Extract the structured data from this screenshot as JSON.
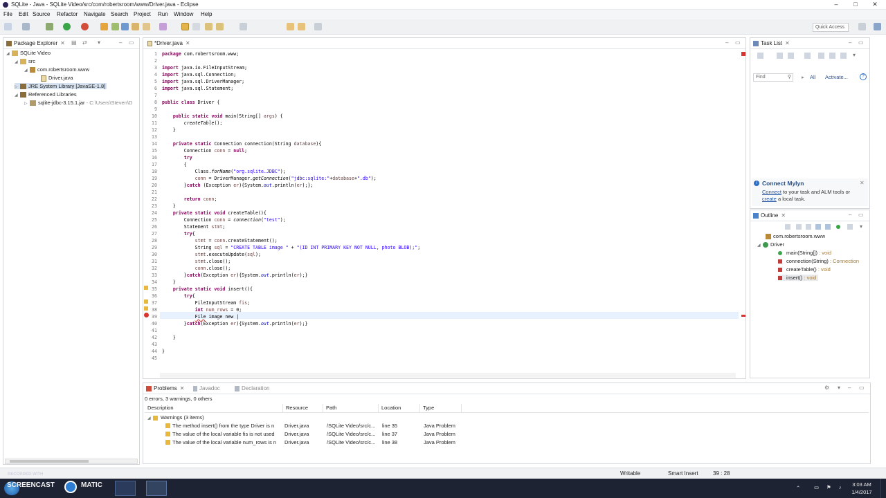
{
  "window": {
    "title": "SQLite - Java - SQLite Video/src/com/robertsroom/www/Driver.java - Eclipse",
    "minimize": "–",
    "maximize": "□",
    "close": "✕"
  },
  "menu": [
    "File",
    "Edit",
    "Source",
    "Refactor",
    "Navigate",
    "Search",
    "Project",
    "Run",
    "Window",
    "Help"
  ],
  "toolbar": {
    "quick_access": "Quick Access"
  },
  "package_explorer": {
    "tab": "Package Explorer",
    "items": [
      {
        "label": "SQLite Video",
        "sub": ""
      },
      {
        "label": "src",
        "sub": ""
      },
      {
        "label": "com.robertsroom.www",
        "sub": ""
      },
      {
        "label": "Driver.java",
        "sub": ""
      },
      {
        "label": "JRE System Library [JavaSE-1.8]",
        "sub": ""
      },
      {
        "label": "Referenced Libraries",
        "sub": ""
      },
      {
        "label": "sqlite-jdbc-3.15.1.jar",
        "sub": " - C:\\Users\\Steven\\D"
      }
    ]
  },
  "editor": {
    "tab": "*Driver.java",
    "lines": [
      "1",
      "2",
      "3",
      "4",
      "5",
      "6",
      "7",
      "8",
      "9",
      "10",
      "11",
      "12",
      "13",
      "14",
      "15",
      "16",
      "17",
      "18",
      "19",
      "20",
      "21",
      "22",
      "23",
      "24",
      "25",
      "26",
      "27",
      "28",
      "29",
      "30",
      "31",
      "32",
      "33",
      "34",
      "35",
      "36",
      "37",
      "38",
      "39",
      "40",
      "41",
      "42",
      "43",
      "44",
      "45"
    ]
  },
  "task_list": {
    "tab": "Task List",
    "find_placeholder": "Find",
    "all": "All",
    "activate": "Activate..."
  },
  "mylyn": {
    "title": "Connect Mylyn",
    "connect": "Connect",
    "text1": " to your task and ALM tools or",
    "create": "create",
    "text2": " a local task."
  },
  "outline": {
    "tab": "Outline",
    "package": "com.robertsroom.www",
    "class": "Driver",
    "members": [
      {
        "name": "main(String[])",
        "type": " : void"
      },
      {
        "name": "connection(String)",
        "type": " : Connection"
      },
      {
        "name": "createTable()",
        "type": " : void"
      },
      {
        "name": "insert()",
        "type": " : void"
      }
    ]
  },
  "problems": {
    "tabs": [
      "Problems",
      "Javadoc",
      "Declaration"
    ],
    "summary": "0 errors, 3 warnings, 0 others",
    "columns": [
      "Description",
      "Resource",
      "Path",
      "Location",
      "Type"
    ],
    "group": "Warnings (3 items)",
    "rows": [
      {
        "description": "The method insert() from the type Driver is n",
        "resource": "Driver.java",
        "path": "/SQLite Video/src/c...",
        "location": "line 35",
        "type": "Java Problem"
      },
      {
        "description": "The value of the local variable fis is not used",
        "resource": "Driver.java",
        "path": "/SQLite Video/src/c...",
        "location": "line 37",
        "type": "Java Problem"
      },
      {
        "description": "The value of the local variable num_rows is n",
        "resource": "Driver.java",
        "path": "/SQLite Video/src/c...",
        "location": "line 38",
        "type": "Java Problem"
      }
    ]
  },
  "status": {
    "writable": "Writable",
    "insert_mode": "Smart Insert",
    "position": "39 : 28"
  },
  "taskbar": {
    "watermark1": "RECORDED WITH",
    "watermark2": "SCREENCAST",
    "watermark3": "MATIC",
    "time": "3:03 AM",
    "date": "1/4/2017"
  },
  "colors": {
    "keyword": "#7f0055",
    "string": "#2a00ff",
    "field": "#0000c0",
    "selection": "#e8f2fe",
    "taskbar": "#1d2333"
  }
}
